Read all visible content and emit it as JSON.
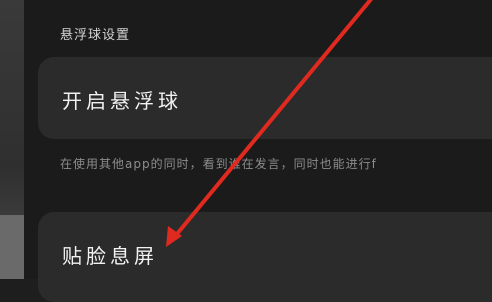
{
  "settings": {
    "section_title": "悬浮球设置",
    "floating_ball_label": "开启悬浮球",
    "description": "在使用其他app的同时，看到谁在发言，同时也能进行f",
    "screen_attach_label": "贴脸息屏"
  },
  "annotation": {
    "arrow_color": "#e02a1f"
  }
}
